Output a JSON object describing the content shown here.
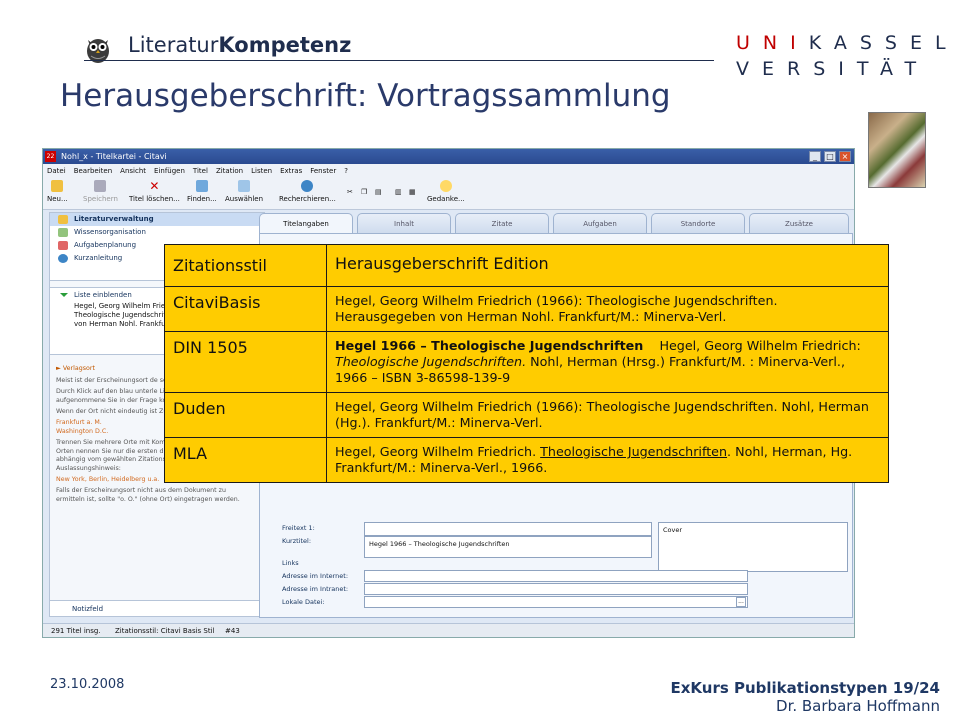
{
  "header": {
    "brand_part1": "Literatur",
    "brand_part2": "Kompetenz",
    "uni_line1_red": "UNI",
    "uni_line1_rest": "KASSEL",
    "uni_line2": "VERSITÄT",
    "title": "Herausgeberschrift: Vortragssammlung"
  },
  "app": {
    "window_title": "Nohl_x - Titelkartei - Citavi",
    "window_icon": "22",
    "menu": [
      "Datei",
      "Bearbeiten",
      "Ansicht",
      "Einfügen",
      "Titel",
      "Zitation",
      "Listen",
      "Extras",
      "Fenster",
      "?"
    ],
    "toolbar": {
      "neu": "Neu...",
      "speichern": "Speichern",
      "titel_loeschen": "Titel löschen...",
      "finden": "Finden...",
      "auswaehlen": "Auswählen",
      "recherchieren": "Recherchieren...",
      "gedanke": "Gedanke..."
    },
    "nav": [
      "Literaturverwaltung",
      "Wissensorganisation",
      "Aufgabenplanung",
      "Kurzanleitung"
    ],
    "list_header": "Liste einblenden",
    "list_entry_lines": [
      "Hegel, Georg Wilhelm Friedrich (",
      "Theologische Jugendschriften",
      "von Herman Nohl. Frankfu"
    ],
    "help": {
      "heading": "Verlagsort",
      "p1": "Meist ist der Erscheinungsort de seinen Stammsitz hat.",
      "p2": "Durch Klick auf den blau unterle Liste der schon aufgenommene Sie in der Frage kommende übernehmen.",
      "p3": "Wenn der Ort nicht eindeutig ist Zusätze:",
      "ex1": "Frankfurt a. M.",
      "ex2": "Washington D.C.",
      "p4": "Trennen Sie mehrere Orte mit Kommata ab. Bei vier und mehr Orten nennen Sie nur die ersten drei und ergänzen Sie abhängig vom gewählten Zitationsstil einen Auslassungshinweis:",
      "ex3": "New York, Berlin, Heidelberg u.a.",
      "p5": "Falls der Erscheinungsort nicht aus dem Dokument zu ermitteln ist, sollte \"o. O.\" (ohne Ort) eingetragen werden."
    },
    "notizfeld": "Notizfeld",
    "tabs": [
      "Titelangaben",
      "Inhalt",
      "Zitate",
      "Aufgaben",
      "Standorte",
      "Zusätze"
    ],
    "fields": {
      "freitext": "Freitext 1:",
      "kurztitel": "Kurztitel:",
      "kurztitel_value": "Hegel 1966 – Theologische Jugendschriften",
      "links": "Links",
      "adresse_internet": "Adresse im Internet:",
      "adresse_intranet": "Adresse im Intranet:",
      "lokale_datei": "Lokale Datei:",
      "cover": "Cover",
      "browse": "..."
    },
    "status": {
      "count": "291 Titel insg.",
      "style": "Zitationsstil: Citavi Basis Stil",
      "index": "#43"
    }
  },
  "table": {
    "header_key": "Zitationsstil",
    "header_value": "Herausgeberschrift Edition",
    "rows": [
      {
        "key": "CitaviBasis",
        "text": "Hegel, Georg Wilhelm Friedrich (1966): Theologische Jugendschriften. Herausgegeben von Herman Nohl. Frankfurt/M.: Minerva-Verl."
      },
      {
        "key": "DIN 1505",
        "bold": "Hegel 1966 – Theologische Jugendschriften",
        "pre": "Hegel, Georg Wilhelm Friedrich: ",
        "italic": "Theologische Jugendschriften.",
        "post": " Nohl, Herman (Hrsg.) Frankfurt/M. : Minerva-Verl., 1966 – ISBN 3-86598-139-9"
      },
      {
        "key": "Duden",
        "text": "Hegel, Georg Wilhelm Friedrich (1966): Theologische Jugendschriften. Nohl, Herman (Hg.). Frankfurt/M.: Minerva-Verl."
      },
      {
        "key": "MLA",
        "pre": "Hegel, Georg Wilhelm Friedrich. ",
        "underline": "Theologische Jugendschriften",
        "post": ". Nohl, Herman, Hg. Frankfurt/M.: Minerva-Verl., 1966."
      }
    ]
  },
  "footer": {
    "date": "23.10.2008",
    "line1": "ExKurs Publikationstypen 19/24",
    "line2": "Dr. Barbara Hoffmann"
  },
  "colors": {
    "table_bg": "#ffcc00",
    "title": "#2a3a6a",
    "uni_red": "#c00000"
  }
}
